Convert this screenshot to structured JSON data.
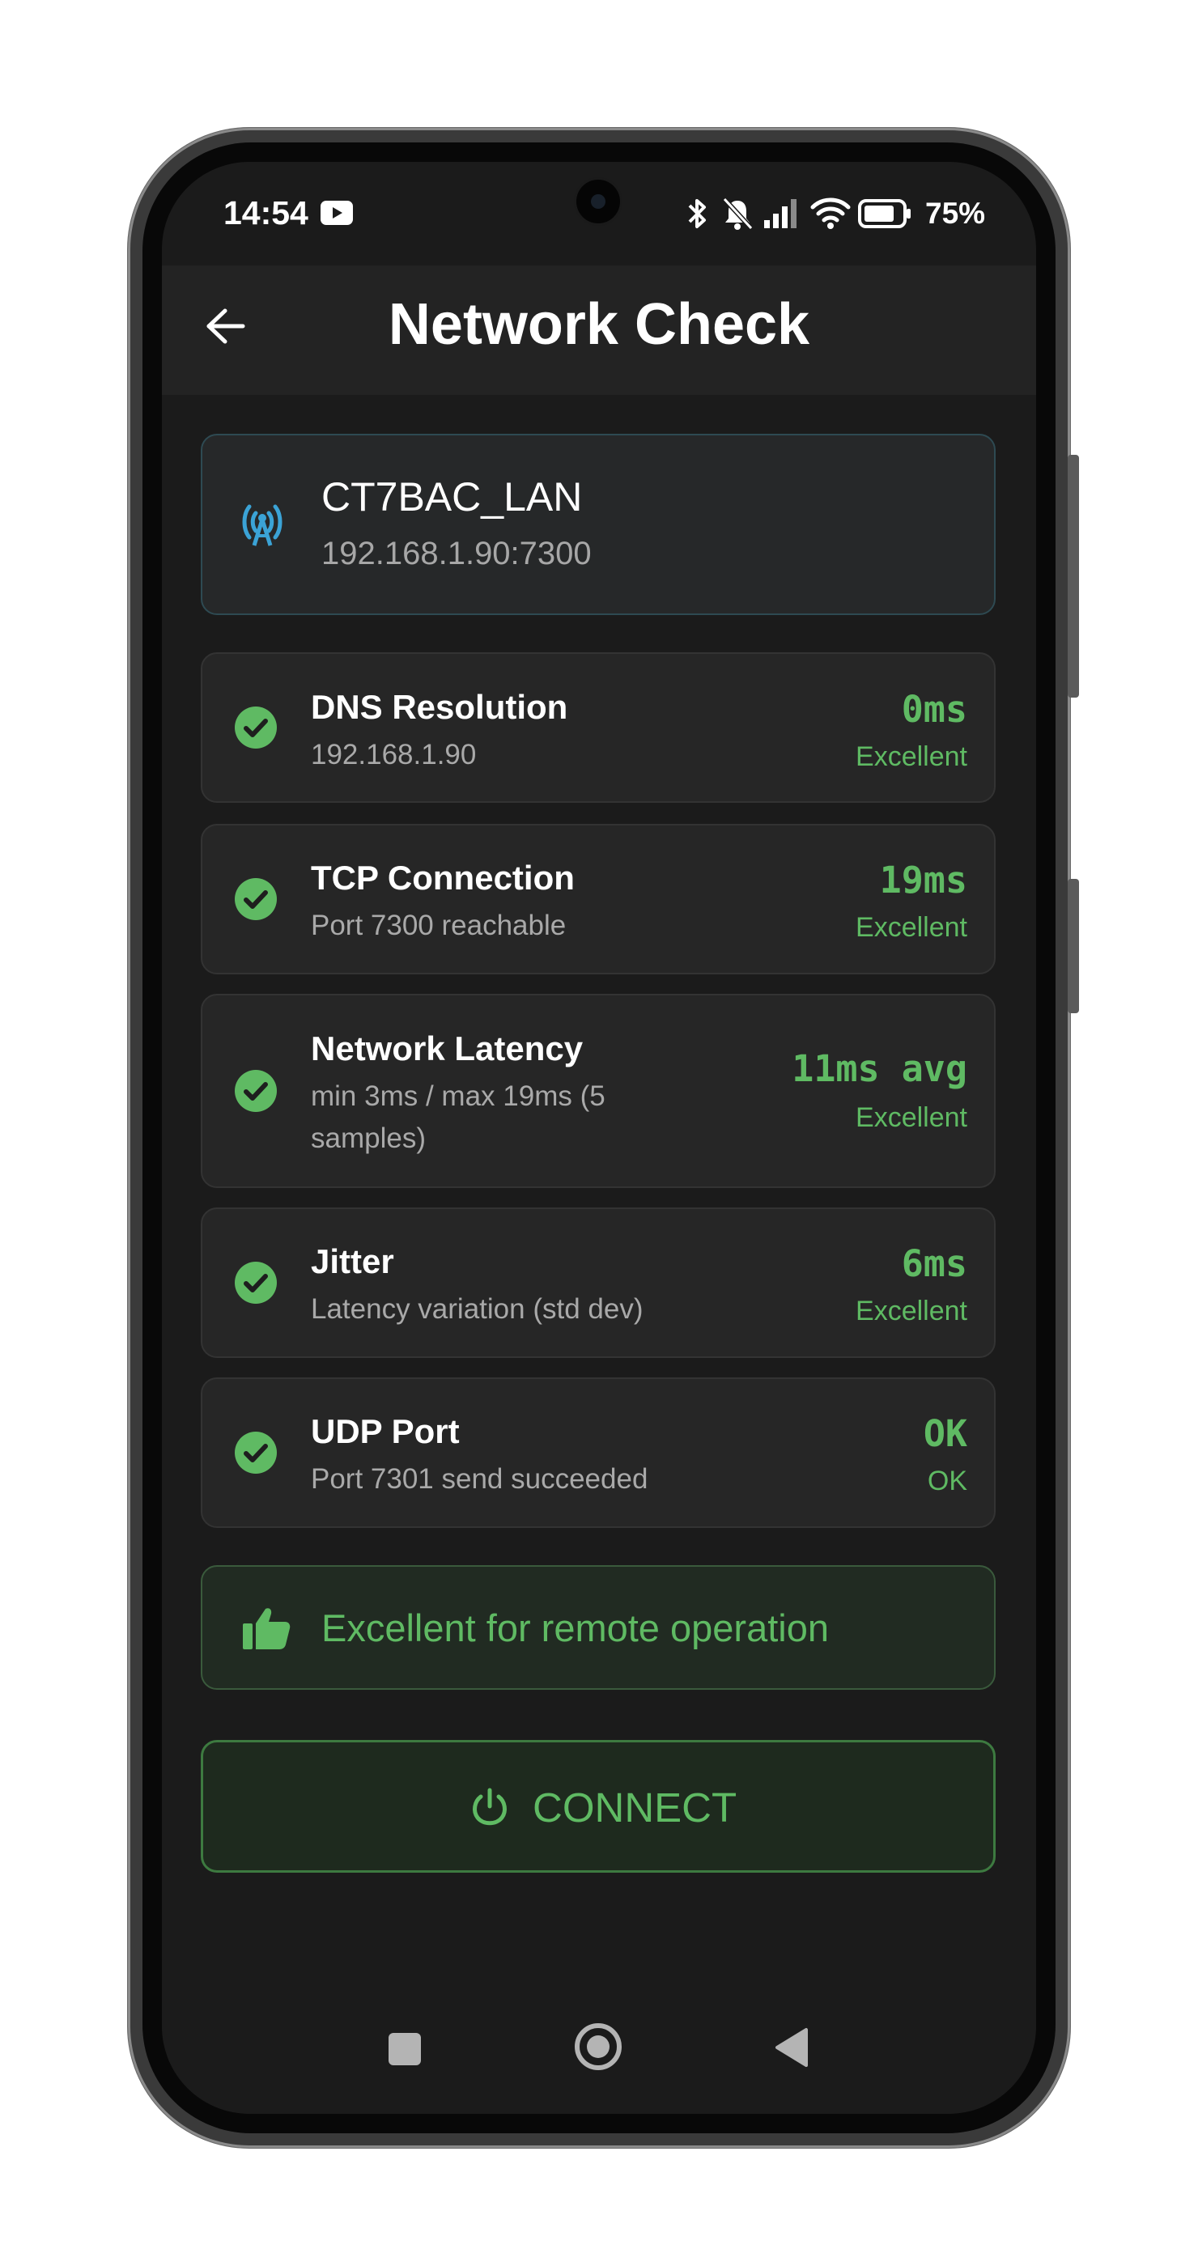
{
  "status_bar": {
    "time": "14:54",
    "battery_text": "75%",
    "icons": [
      "youtube-icon",
      "bluetooth-icon",
      "bell-off-icon",
      "signal-icon",
      "wifi-icon",
      "battery-icon"
    ]
  },
  "app_bar": {
    "back_icon": "arrow-left-icon",
    "title": "Network Check"
  },
  "network": {
    "icon": "antenna-icon",
    "name": "CT7BAC_LAN",
    "address": "192.168.1.90:7300"
  },
  "checks": [
    {
      "title": "DNS Resolution",
      "subtitle": "192.168.1.90",
      "value": "0ms",
      "grade": "Excellent"
    },
    {
      "title": "TCP Connection",
      "subtitle": "Port 7300 reachable",
      "value": "19ms",
      "grade": "Excellent"
    },
    {
      "title": "Network Latency",
      "subtitle_line1": "min 3ms / max 19ms (5",
      "subtitle_line2": "samples)",
      "value": "11ms avg",
      "grade": "Excellent"
    },
    {
      "title": "Jitter",
      "subtitle": "Latency variation (std dev)",
      "value": "6ms",
      "grade": "Excellent"
    },
    {
      "title": "UDP Port",
      "subtitle": "Port 7301 send succeeded",
      "value": "OK",
      "grade": "OK"
    }
  ],
  "verdict": {
    "icon": "thumbs-up-icon",
    "text": "Excellent for remote operation"
  },
  "connect_button": {
    "icon": "power-icon",
    "label": "CONNECT"
  },
  "colors": {
    "accent_green": "#5fba63",
    "network_icon_blue": "#3ba3d6",
    "background": "#1b1b1b",
    "card": "#262626"
  }
}
